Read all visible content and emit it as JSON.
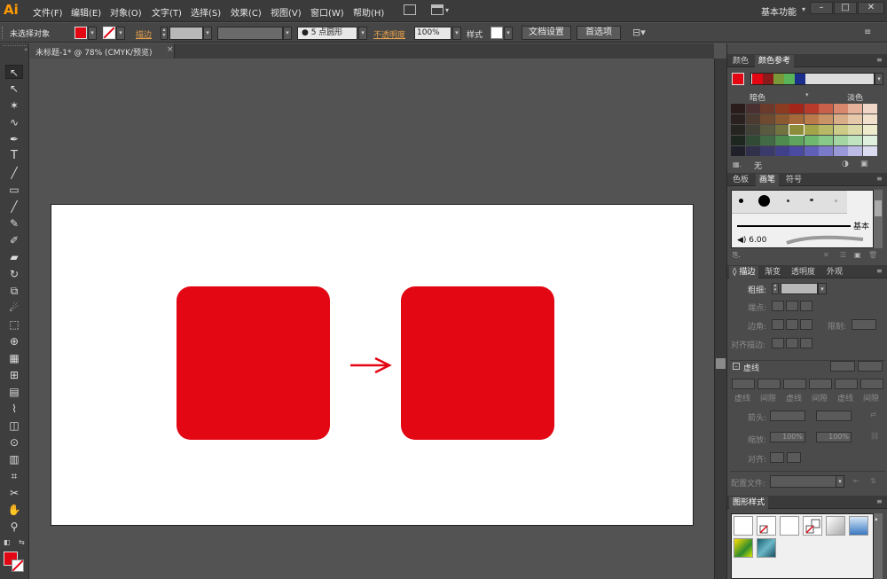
{
  "app": {
    "logo": "Ai"
  },
  "menu": [
    "文件(F)",
    "编辑(E)",
    "对象(O)",
    "文字(T)",
    "选择(S)",
    "效果(C)",
    "视图(V)",
    "窗口(W)",
    "帮助(H)"
  ],
  "workspace": "基本功能",
  "control": {
    "selection": "未选择对象",
    "stroke_label": "描边",
    "brush_value": "5 点圆形",
    "opacity_label": "不透明度",
    "opacity_value": "100%",
    "style_label": "样式",
    "doc_setup": "文档设置",
    "prefs": "首选项"
  },
  "document": {
    "tab": "未标题-1* @ 78% (CMYK/预览)",
    "close": "×"
  },
  "colors": {
    "accent": "#e30613",
    "arrow": "#e30613"
  },
  "color_panel": {
    "tabs": [
      "颜色",
      "颜色参考"
    ],
    "dark_label": "暗色",
    "light_label": "淡色",
    "none_label": "无",
    "harmony": [
      "#e30613",
      "#8b1a1a",
      "#7a9a3a",
      "#59b359",
      "#1c2e8c"
    ],
    "grid": [
      [
        "#2b1c1c",
        "#4a3030",
        "#6b3a2a",
        "#8c3a20",
        "#a3261a",
        "#b83a2a",
        "#c9604a",
        "#d9886d",
        "#e6b29a",
        "#f0d6c7"
      ],
      [
        "#2a2020",
        "#4a3a30",
        "#6e4a30",
        "#8c5a30",
        "#a66a3a",
        "#bb7a4a",
        "#c99366",
        "#d9ad88",
        "#e6c8aa",
        "#f0e0cc"
      ],
      [
        "#262420",
        "#404036",
        "#5a5a40",
        "#737340",
        "#8c8c3a",
        "#a3a34a",
        "#b8b866",
        "#cccc88",
        "#dddaaa",
        "#eeeccd"
      ],
      [
        "#1e2620",
        "#304a36",
        "#406b44",
        "#4f8a4f",
        "#5fa35f",
        "#6fb86f",
        "#88c888",
        "#a3d6a3",
        "#c0e3c0",
        "#dff0df"
      ],
      [
        "#20202a",
        "#30304a",
        "#3a3a6b",
        "#40408a",
        "#4a4aa3",
        "#6060b8",
        "#7a7ac9",
        "#9999d9",
        "#bbbbe6",
        "#dcdcf0"
      ]
    ]
  },
  "brush_panel": {
    "tabs": [
      "色板",
      "画笔",
      "符号"
    ],
    "basic": "基本",
    "size": "6.00"
  },
  "stroke_panel": {
    "tabs": [
      "描边",
      "渐变",
      "透明度",
      "外观"
    ],
    "weight": "粗细:",
    "cap": "端点:",
    "corner": "边角:",
    "limit": "限制:",
    "align": "对齐描边:",
    "dashed": "虚线",
    "dash": [
      "虚线",
      "间隙",
      "虚线",
      "间隙",
      "虚线",
      "间隙"
    ],
    "arrow": "箭头:",
    "scale": "缩放:",
    "scale1": "100%",
    "scale2": "100%",
    "alignment": "对齐:",
    "profile": "配置文件:"
  },
  "graphic_styles": {
    "title": "图形样式"
  }
}
